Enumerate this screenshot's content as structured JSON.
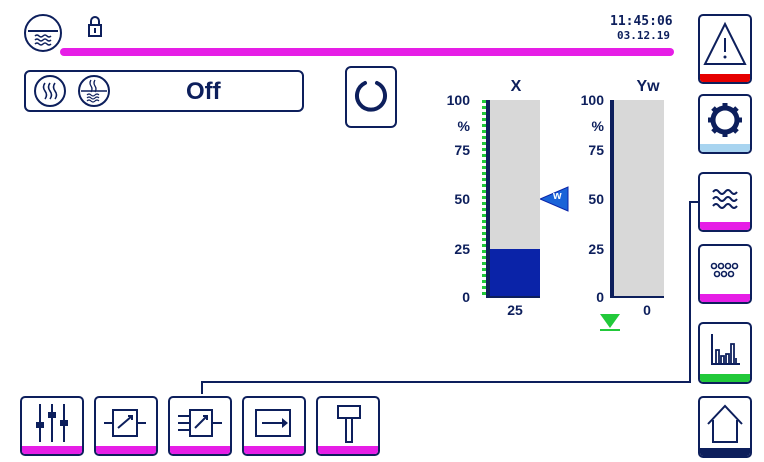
{
  "header": {
    "time": "11:45:06",
    "date": "03.12.19",
    "progress_color": "#e61ee6"
  },
  "status": {
    "mode_label": "Off",
    "icons": [
      "heat-exchange-icon",
      "water-heat-icon"
    ]
  },
  "gauges": {
    "x": {
      "title": "X",
      "value_label": "25",
      "value_pct": 25,
      "setpoint_label": "w",
      "setpoint_pct": 50,
      "ticks": [
        "100",
        "%",
        "75",
        "50",
        "25",
        "0"
      ],
      "fill_color": "#0a23a8"
    },
    "yw": {
      "title": "Yw",
      "value_label": "0",
      "value_pct": 0,
      "ticks": [
        "100",
        "%",
        "75",
        "50",
        "25",
        "0"
      ]
    }
  },
  "right_nav": [
    {
      "name": "alarm",
      "icon": "warning-icon",
      "stripe": "#e60000"
    },
    {
      "name": "settings",
      "icon": "gear-icon",
      "stripe": "#a8d4f0"
    },
    {
      "name": "water",
      "icon": "waves-icon",
      "stripe": "#e61ee6"
    },
    {
      "name": "dots",
      "icon": "dots-icon",
      "stripe": "#e61ee6"
    },
    {
      "name": "trend",
      "icon": "bar-chart-icon",
      "stripe": "#22c93a"
    },
    {
      "name": "home",
      "icon": "home-icon",
      "stripe": "#0d1f5c"
    }
  ],
  "bottom_nav": [
    {
      "name": "mixer",
      "icon": "sliders-icon",
      "stripe": "#e61ee6"
    },
    {
      "name": "function-block",
      "icon": "block-icon",
      "stripe": "#e61ee6"
    },
    {
      "name": "input-block",
      "icon": "input-block-icon",
      "stripe": "#e61ee6"
    },
    {
      "name": "output",
      "icon": "arrow-out-icon",
      "stripe": "#e61ee6"
    },
    {
      "name": "valve",
      "icon": "valve-icon",
      "stripe": "#e61ee6"
    }
  ]
}
